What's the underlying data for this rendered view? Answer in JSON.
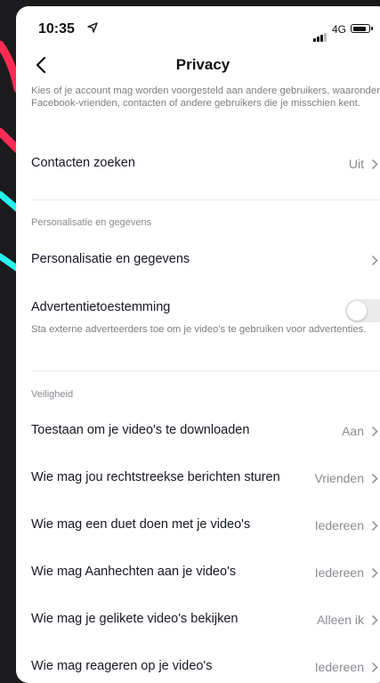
{
  "status_bar": {
    "time": "10:35",
    "network": "4G"
  },
  "nav": {
    "title": "Privacy"
  },
  "top_description": "Kies of je account mag worden voorgesteld aan andere gebruikers, waaronder Facebook-vrienden, contacten of andere gebruikers die je misschien kent.",
  "contacts": {
    "label": "Contacten zoeken",
    "value": "Uit"
  },
  "personalization": {
    "section_title": "Personalisatie en gegevens",
    "row_label": "Personalisatie en gegevens",
    "ad_consent_label": "Advertentietoestemming",
    "ad_consent_description": "Sta externe adverteerders toe om je video's te gebruiken voor advertenties.",
    "ad_consent_enabled": false
  },
  "security": {
    "section_title": "Veiligheid",
    "rows": [
      {
        "label": "Toestaan om je video's te downloaden",
        "value": "Aan"
      },
      {
        "label": "Wie mag jou rechtstreekse berichten sturen",
        "value": "Vrienden"
      },
      {
        "label": "Wie mag een duet doen met je video's",
        "value": "Iedereen"
      },
      {
        "label": "Wie mag Aanhechten aan je video's",
        "value": "Iedereen"
      },
      {
        "label": "Wie mag je gelikete video's bekijken",
        "value": "Alleen ik"
      },
      {
        "label": "Wie mag reageren op je video's",
        "value": "Iedereen"
      }
    ]
  },
  "colors": {
    "background": "#1b1b1d",
    "accent_red": "#fe2c55",
    "accent_cyan": "#25f4ee"
  }
}
